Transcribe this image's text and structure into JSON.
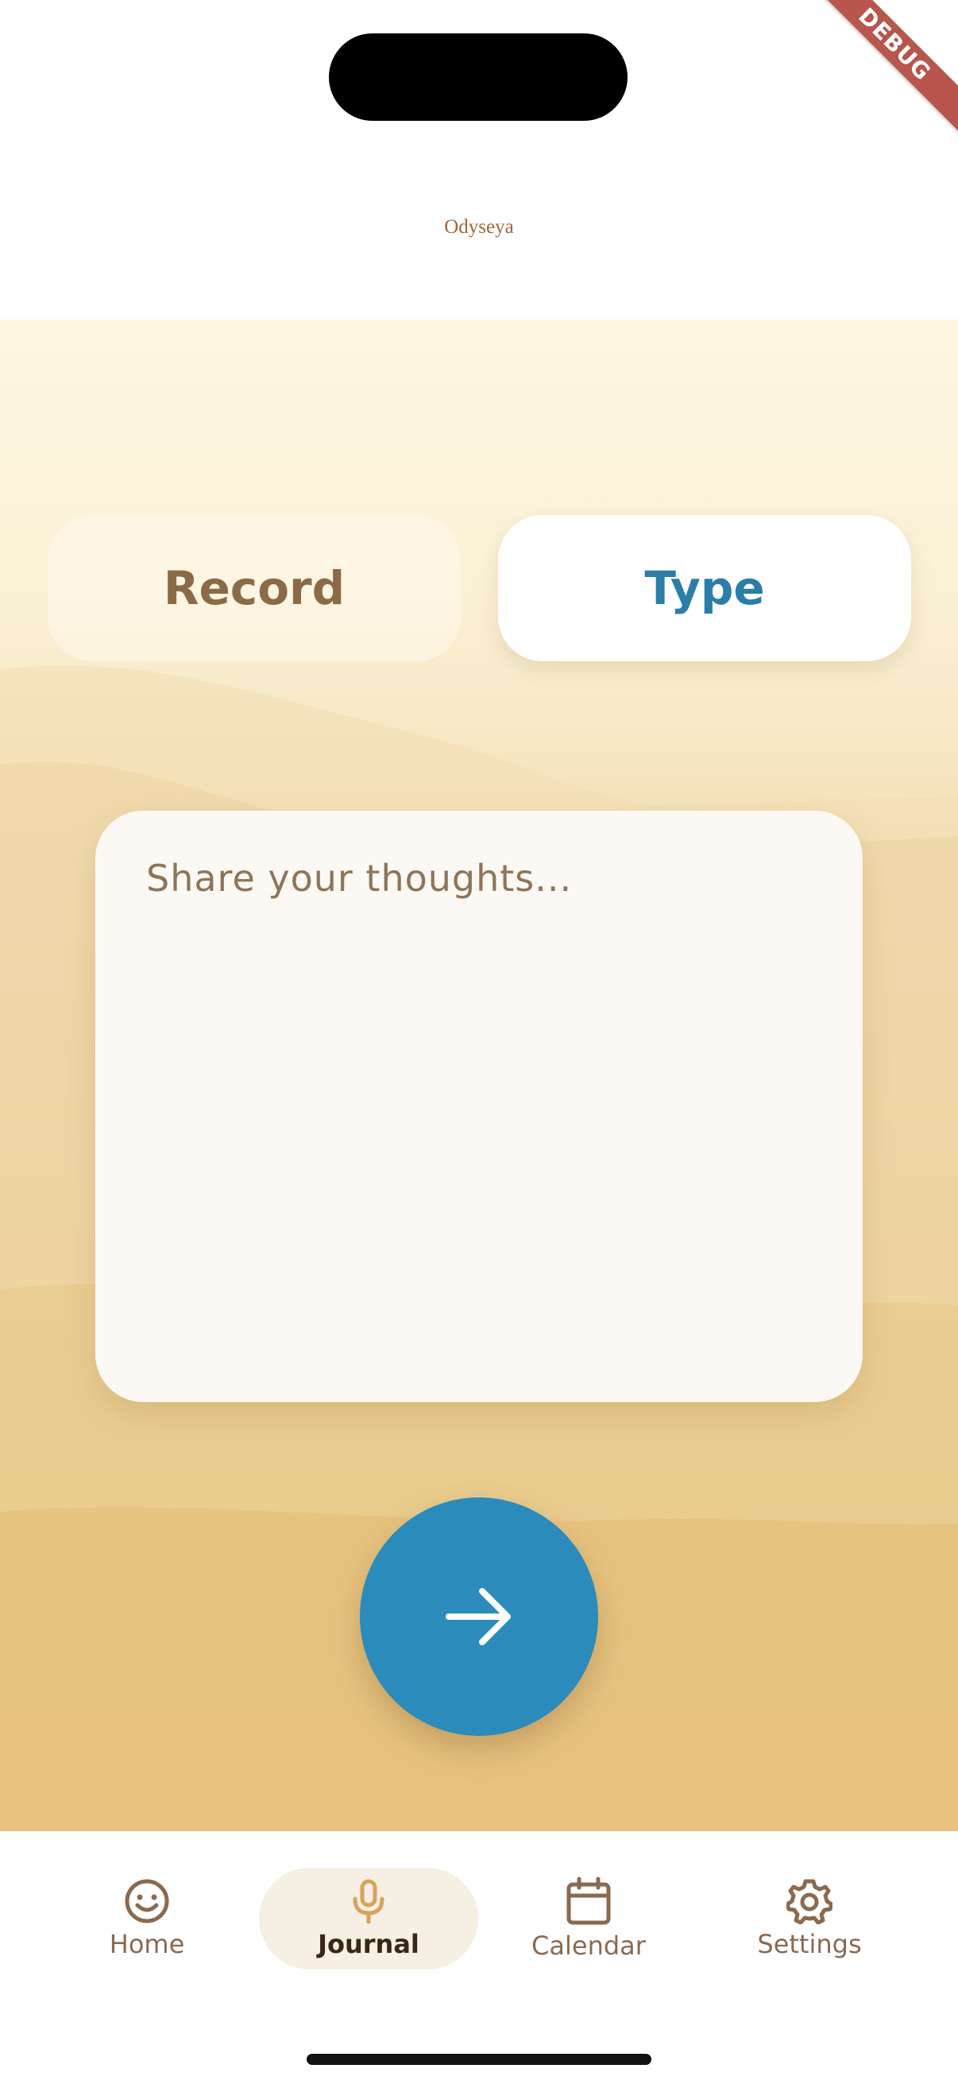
{
  "app": {
    "title": "Odyseya",
    "debug_banner": "DEBUG"
  },
  "mode_toggle": {
    "record_label": "Record",
    "type_label": "Type",
    "selected": "Type"
  },
  "journal_input": {
    "placeholder": "Share your thoughts...",
    "value": ""
  },
  "submit": {
    "icon": "arrow-right-icon"
  },
  "nav": {
    "items": [
      {
        "label": "Home",
        "icon": "smiley-icon"
      },
      {
        "label": "Journal",
        "icon": "microphone-icon"
      },
      {
        "label": "Calendar",
        "icon": "calendar-icon"
      },
      {
        "label": "Settings",
        "icon": "gear-icon"
      }
    ],
    "active": "Journal"
  },
  "colors": {
    "accent": "#2b8bbb",
    "title": "#a3653a",
    "nav_text": "#8a6a50",
    "active_icon": "#d9a15a"
  }
}
